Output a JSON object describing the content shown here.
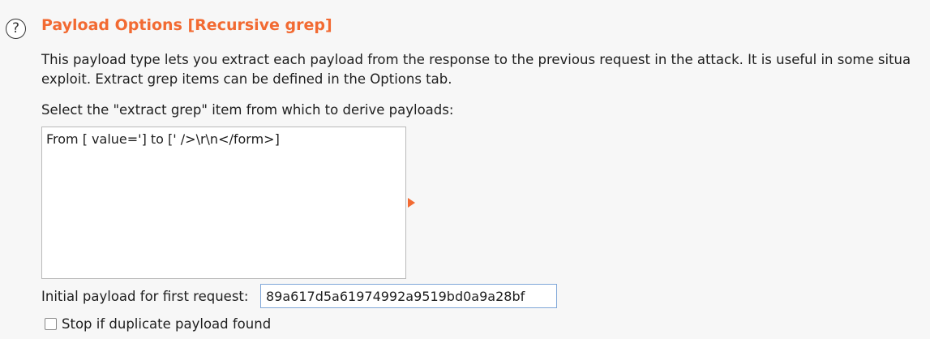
{
  "section": {
    "help_glyph": "?",
    "title": "Payload Options [Recursive grep]",
    "description_line1": "This payload type lets you extract each payload from the response to the previous request in the attack. It is useful in some situa",
    "description_line2": "exploit. Extract grep items can be defined in the Options tab.",
    "accent_color": "#f26a32"
  },
  "extract_grep": {
    "label": "Select the \"extract grep\" item from which to derive payloads:",
    "items": [
      "From [ value='] to [' />\\r\\n</form>]"
    ]
  },
  "initial_payload": {
    "label": "Initial payload for first request:",
    "value": "89a617d5a61974992a9519bd0a9a28bf"
  },
  "stop_duplicate": {
    "label": "Stop if duplicate payload found",
    "checked": false
  }
}
